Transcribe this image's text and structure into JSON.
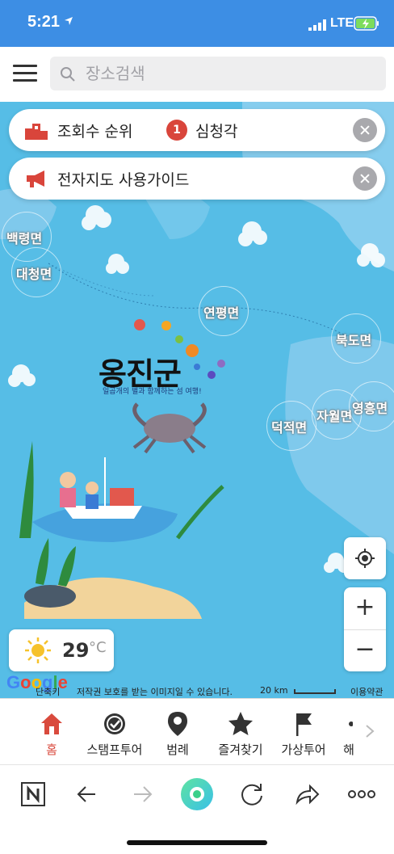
{
  "status_bar": {
    "time": "5:21",
    "network": "LTE"
  },
  "header": {
    "search_placeholder": "장소검색"
  },
  "map": {
    "ranking_banner": {
      "label": "조회수 순위",
      "rank": "1",
      "place": "심청각"
    },
    "guide_banner": {
      "label": "전자지도 사용가이드"
    },
    "places": [
      "백령면",
      "대청면",
      "연평면",
      "북도면",
      "덕적면",
      "자월면",
      "영흥면"
    ],
    "county_title": "옹진군",
    "county_subtitle": "일곱개의 별과 함께하는 섬 여행!",
    "weather": {
      "temperature": "29",
      "unit": "°C",
      "icon": "sun-icon"
    },
    "attribution": {
      "google": "Google",
      "shortcut": "단축키",
      "copyright": "저작권 보호를 받는 이미지일 수 있습니다.",
      "scale": "20 km",
      "terms": "이용약관"
    },
    "colors": {
      "sea": "#56bde6",
      "land": "#86cdee",
      "accent": "#d9453b"
    }
  },
  "tabbar": {
    "tabs": [
      {
        "label": "홈",
        "icon": "home-icon",
        "active": true
      },
      {
        "label": "스탬프투어",
        "icon": "stamp-badge-icon",
        "active": false
      },
      {
        "label": "범례",
        "icon": "map-pin-icon",
        "active": false
      },
      {
        "label": "즐겨찾기",
        "icon": "star-icon",
        "active": false
      },
      {
        "label": "가상투어",
        "icon": "flag-icon",
        "active": false
      },
      {
        "label": "해",
        "icon": "partial-icon",
        "active": false
      }
    ]
  },
  "browser": {
    "buttons": [
      "n-logo-icon",
      "back-icon",
      "forward-icon",
      "green-dot-icon",
      "refresh-icon",
      "share-icon",
      "more-icon"
    ]
  }
}
